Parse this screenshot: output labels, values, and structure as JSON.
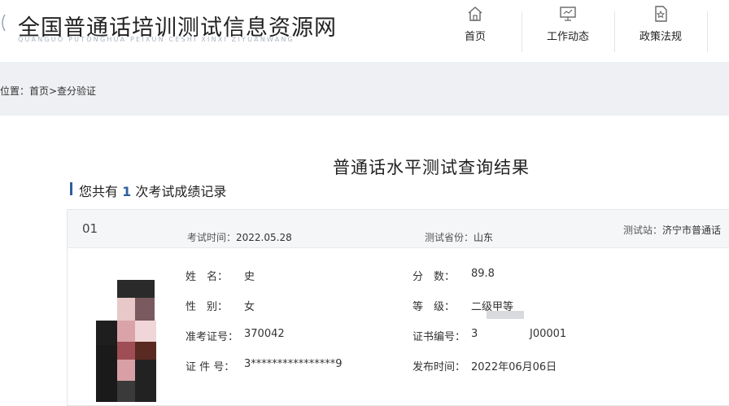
{
  "header": {
    "title": "全国普通话培训测试信息资源网",
    "pinyin": "QUANGUO PUTONGHUA PEIXUN CESHI XINXI ZIYUANWANG",
    "nav": [
      {
        "label": "首页",
        "icon": "home-icon"
      },
      {
        "label": "工作动态",
        "icon": "monitor-icon"
      },
      {
        "label": "政策法规",
        "icon": "document-icon"
      }
    ]
  },
  "breadcrumb": "位置：首页>查分验证",
  "main": {
    "title": "普通话水平测试查询结果",
    "count_prefix": "您共有",
    "count": "1",
    "count_suffix": "次考试成绩记录"
  },
  "record": {
    "number": "01",
    "exam_time_label": "考试时间：",
    "exam_time": "2022.05.28",
    "province_label": "测试省份：",
    "province": "山东",
    "station_label": "测试站：",
    "station": "济宁市普通话",
    "fields_left": [
      {
        "label": "姓　名：",
        "value": "史"
      },
      {
        "label": "性　别：",
        "value": "女"
      },
      {
        "label": "准考证号：",
        "value": "370042"
      },
      {
        "label": "证 件 号：",
        "value": "3****************9"
      }
    ],
    "fields_right": [
      {
        "label": "分　数：",
        "value": "89.8"
      },
      {
        "label": "等　级：",
        "value": "二级甲等"
      },
      {
        "label": "证书编号：",
        "value": "3"
      },
      {
        "label": "发布时间：",
        "value": "2022年06月06日"
      }
    ],
    "cert_suffix": "J00001"
  },
  "colors": {
    "accent": "#2f5f9e",
    "band": "#eef0f3"
  }
}
